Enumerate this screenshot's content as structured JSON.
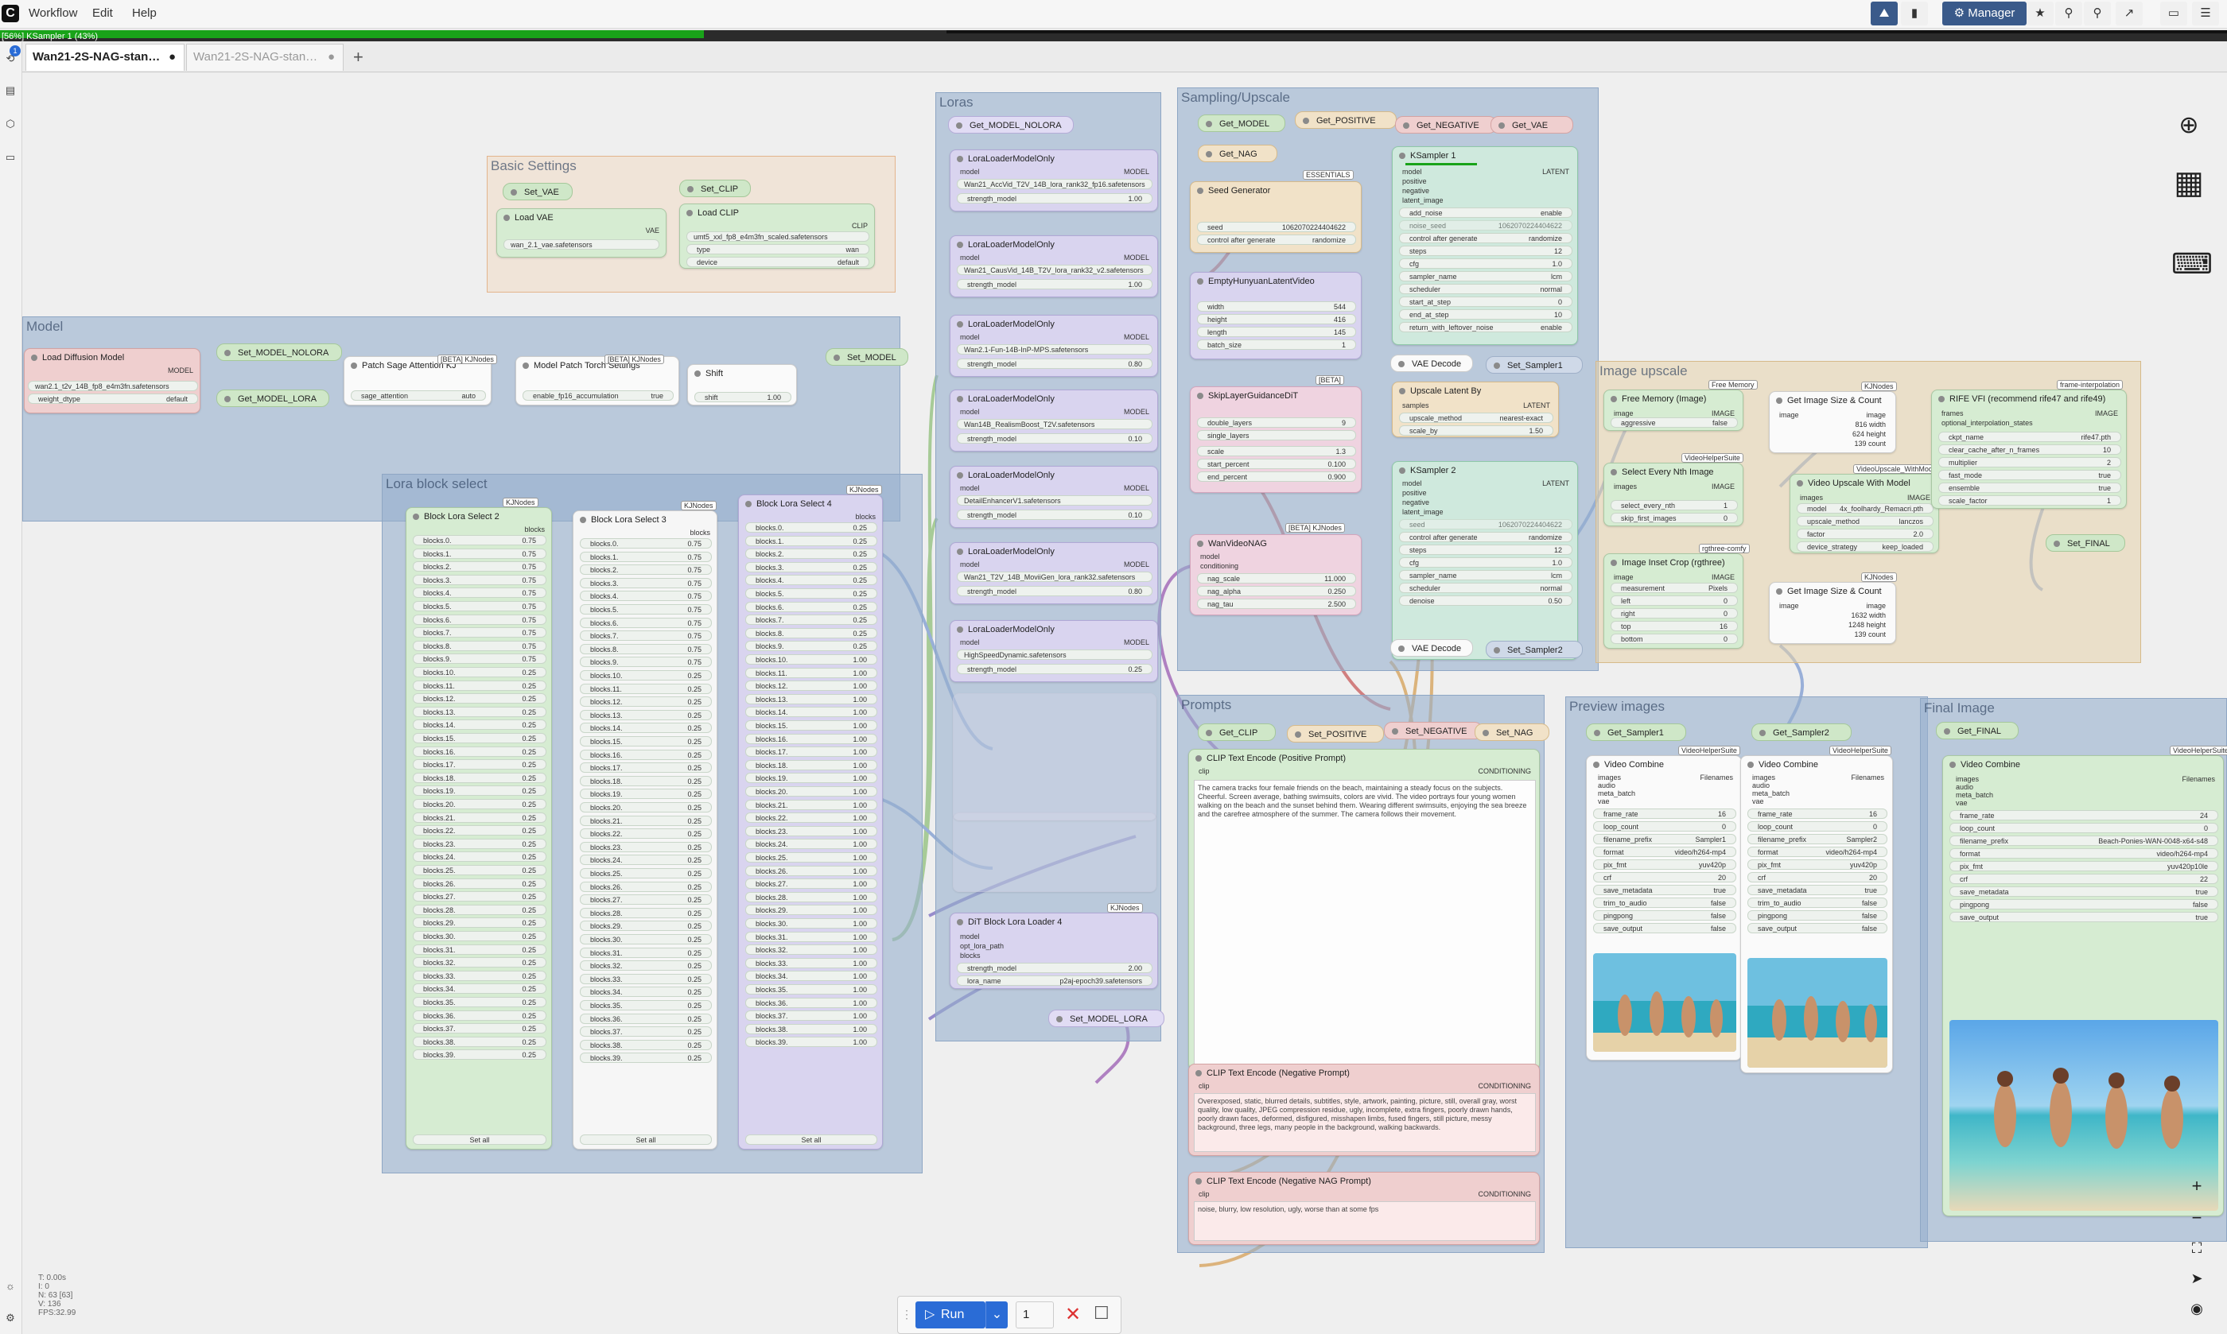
{
  "menu": {
    "items": [
      "Workflow",
      "Edit",
      "Help"
    ],
    "logo": "C"
  },
  "toolbar": {
    "manager_label": "Manager"
  },
  "progress": {
    "text": "[56%] KSampler 1 (43%)",
    "fraction": 0.56,
    "color": "#19a319"
  },
  "tabs": [
    {
      "label": "Wan21-2S-NAG-stan…",
      "active": true
    },
    {
      "label": "Wan21-2S-NAG-stan…",
      "active": false
    }
  ],
  "tab_add": "+",
  "sidebar": {
    "badge_count": "1"
  },
  "groups": {
    "basic_settings": "Basic Settings",
    "model": "Model",
    "lora_block_select": "Lora block select",
    "loras": "Loras",
    "sampling": "Sampling/Upscale",
    "image_upscale": "Image upscale",
    "prompts": "Prompts",
    "preview_images": "Preview images",
    "final_image": "Final Image"
  },
  "basic_settings": {
    "set_vae": "Set_VAE",
    "set_clip": "Set_CLIP",
    "load_vae": "Load VAE",
    "load_clip": "Load CLIP",
    "vae_name": "wan_2.1_vae.safetensors",
    "clip_name": "umt5_xxl_fp8_e4m3fn_scaled.safetensors",
    "clip_type": "wan",
    "clip_device": "default",
    "vae_out": "VAE",
    "clip_out": "CLIP"
  },
  "model": {
    "load_diffusion": "Load Diffusion Model",
    "unet_name": "wan2.1_t2v_14B_fp8_e4m3fn.safetensors",
    "weight_dtype": "default",
    "set_model_nolora": "Set_MODEL_NOLORA",
    "get_model_lora": "Get_MODEL_LORA",
    "patch_sage": "Patch Sage Attention KJ",
    "sage_attention": "auto",
    "patch_torch": "Model Patch Torch Settings",
    "enable_fp16": "true",
    "shift": "Shift",
    "shift_value": "1.00",
    "set_model": "Set_MODEL",
    "badge_kjnodes": "KJNodes",
    "badge_beta": "[BETA] KJNodes"
  },
  "block_lora": {
    "nodes": [
      {
        "title": "Block Lora Select 2"
      },
      {
        "title": "Block Lora Select 3"
      },
      {
        "title": "Block Lora Select 4"
      }
    ],
    "values": [
      [
        "0.75",
        "0.75",
        "0.75",
        "0.75",
        "0.75",
        "0.75",
        "0.75",
        "0.75",
        "0.75",
        "0.75",
        "0.25",
        "0.25",
        "0.25",
        "0.25",
        "0.25",
        "0.25",
        "0.25",
        "0.25",
        "0.25",
        "0.25",
        "0.25",
        "0.25",
        "0.25",
        "0.25",
        "0.25",
        "0.25",
        "0.25",
        "0.25",
        "0.25",
        "0.25",
        "0.25",
        "0.25",
        "0.25",
        "0.25",
        "0.25",
        "0.25",
        "0.25",
        "0.25",
        "0.25",
        "0.25"
      ],
      [
        "0.75",
        "0.75",
        "0.75",
        "0.75",
        "0.75",
        "0.75",
        "0.75",
        "0.75",
        "0.75",
        "0.75",
        "0.25",
        "0.25",
        "0.25",
        "0.25",
        "0.25",
        "0.25",
        "0.25",
        "0.25",
        "0.25",
        "0.25",
        "0.25",
        "0.25",
        "0.25",
        "0.25",
        "0.25",
        "0.25",
        "0.25",
        "0.25",
        "0.25",
        "0.25",
        "0.25",
        "0.25",
        "0.25",
        "0.25",
        "0.25",
        "0.25",
        "0.25",
        "0.25",
        "0.25",
        "0.25"
      ],
      [
        "0.25",
        "0.25",
        "0.25",
        "0.25",
        "0.25",
        "0.25",
        "0.25",
        "0.25",
        "0.25",
        "0.25",
        "1.00",
        "1.00",
        "1.00",
        "1.00",
        "1.00",
        "1.00",
        "1.00",
        "1.00",
        "1.00",
        "1.00",
        "1.00",
        "1.00",
        "1.00",
        "1.00",
        "1.00",
        "1.00",
        "1.00",
        "1.00",
        "1.00",
        "1.00",
        "1.00",
        "1.00",
        "1.00",
        "1.00",
        "1.00",
        "1.00",
        "1.00",
        "1.00",
        "1.00",
        "1.00"
      ]
    ],
    "output": "blocks",
    "set_all": "Set all"
  },
  "loras": {
    "get_model_nolora": "Get_MODEL_NOLORA",
    "nodes": [
      {
        "title": "LoraLoaderModelOnly",
        "lora": "Wan21_AccVid_T2V_14B_lora_rank32_fp16.safetensors",
        "strength": "1.00"
      },
      {
        "title": "LoraLoaderModelOnly",
        "lora": "Wan21_CausVid_14B_T2V_lora_rank32_v2.safetensors",
        "strength": "1.00"
      },
      {
        "title": "LoraLoaderModelOnly",
        "lora": "Wan2.1-Fun-14B-InP-MPS.safetensors",
        "strength": "0.80"
      },
      {
        "title": "LoraLoaderModelOnly",
        "lora": "Wan14B_RealismBoost_T2V.safetensors",
        "strength": "0.10"
      },
      {
        "title": "LoraLoaderModelOnly",
        "lora": "DetailEnhancerV1.safetensors",
        "strength": "0.10"
      },
      {
        "title": "LoraLoaderModelOnly",
        "lora": "Wan21_T2V_14B_MoviiGen_lora_rank32.safetensors",
        "strength": "0.80"
      },
      {
        "title": "LoraLoaderModelOnly",
        "lora": "HighSpeedDynamic.safetensors",
        "strength": "0.25"
      }
    ],
    "dit_block_lora": "DiT Block Lora Loader 4",
    "dit_strength": "2.00",
    "dit_lora": "p2aj-epoch39.safetensors",
    "set_model_lora": "Set_MODEL_LORA"
  },
  "sampling": {
    "get_model": "Get_MODEL",
    "get_positive": "Get_POSITIVE",
    "get_negative": "Get_NEGATIVE",
    "get_vae": "Get_VAE",
    "get_nag": "Get_NAG",
    "seed_generator": "Seed Generator",
    "seed": "1062070224404622",
    "control": "randomize",
    "empty_latent": "EmptyHunyuanLatentVideo",
    "width": "544",
    "height": "416",
    "length": "145",
    "batch_size": "1",
    "skip_layer": "SkipLayerGuidanceDiT",
    "double_layers": "9",
    "single_layers": "",
    "scale": "1.3",
    "start_percent": "0.100",
    "end_percent": "0.900",
    "wan_video_nag": "WanVideoNAG",
    "nag_scale": "11.000",
    "nag_alpha": "0.250",
    "nag_tau": "2.500",
    "ksampler1": "KSampler 1",
    "ksampler2": "KSampler 2",
    "add_noise": "enable",
    "steps": "12",
    "cfg": "1.0",
    "sampler_name": "lcm",
    "scheduler": "normal",
    "start_step": "0",
    "end_step": "10",
    "return_noise": "enable",
    "ks2_start": "10",
    "ks2_end": "10000",
    "ks2_denoise": "0.50",
    "vae_decode": "VAE Decode",
    "set_sampler1": "Set_Sampler1",
    "set_sampler2": "Set_Sampler2",
    "upscale_latent": "Upscale Latent By",
    "upscale_method": "nearest-exact",
    "scale_by": "1.50",
    "ks_progress": 0.43
  },
  "image_upscale": {
    "free_memory": "Free Memory (Image)",
    "aggressive": "false",
    "select_every": "Select Every Nth Image",
    "select_every_nth": "1",
    "skip_first": "0",
    "crop": "Image Inset Crop (rgthree)",
    "measurement": "Pixels",
    "left": "0",
    "right": "0",
    "top": "16",
    "bottom": "0",
    "get_size1": "Get Image Size & Count",
    "w1": "816 width",
    "h1": "624 height",
    "c1": "139 count",
    "upscale_model": "Video Upscale With Model",
    "model_name": "4x_foolhardy_Remacri.pth",
    "upscale_method": "lanczos",
    "factor": "2.0",
    "device": "keep_loaded",
    "get_size2": "Get Image Size & Count",
    "w2": "1632 width",
    "h2": "1248 height",
    "c2": "139 count",
    "rife": "RIFE VFI (recommend rife47 and rife49)",
    "ckpt_name": "rife47.pth",
    "clear_cache": "10",
    "multiplier": "2",
    "fast_mode": "true",
    "ensemble": "true",
    "scale_factor": "1",
    "set_final": "Set_FINAL"
  },
  "prompts": {
    "get_clip": "Get_CLIP",
    "set_positive": "Set_POSITIVE",
    "set_negative": "Set_NEGATIVE",
    "set_nag": "Set_NAG",
    "positive_title": "CLIP Text Encode (Positive Prompt)",
    "positive_text": "The camera tracks four female friends on the beach, maintaining a steady focus on the subjects. Cheerful. Screen average, bathing swimsuits, colors are vivid. The video portrays four young women walking on the beach and the sunset behind them. Wearing different swimsuits, enjoying the sea breeze and the carefree atmosphere of the summer. The camera follows their movement.",
    "negative_title": "CLIP Text Encode (Negative Prompt)",
    "negative_text": "Overexposed, static, blurred details, subtitles, style, artwork, painting, picture, still, overall gray, worst quality, low quality, JPEG compression residue, ugly, incomplete, extra fingers, poorly drawn hands, poorly drawn faces, deformed, disfigured, misshapen limbs, fused fingers, still picture, messy background, three legs, many people in the background, walking backwards.",
    "nag_title": "CLIP Text Encode (Negative NAG Prompt)",
    "nag_text": "noise, blurry, low resolution, ugly, worse than at some fps",
    "clip": "clip",
    "conditioning": "CONDITIONING"
  },
  "preview": {
    "get_sampler1": "Get_Sampler1",
    "get_sampler2": "Get_Sampler2",
    "combine": "Video Combine",
    "frame_rate": "16",
    "loop_count": "0",
    "prefix1": "Sampler1",
    "prefix2": "Sampler2",
    "format": "video/h264-mp4",
    "pix_fmt": "yuv420p",
    "crf": "20",
    "save_metadata": "true",
    "trim_to_audio": "false",
    "pingpong": "false",
    "save_output": "false"
  },
  "final": {
    "get_final": "Get_FINAL",
    "combine": "Video Combine",
    "frame_rate": "24",
    "loop_count": "0",
    "prefix": "Beach-Ponies-WAN-0048-x64-s48",
    "format": "video/h264-mp4",
    "pix_fmt": "yuv420p10le",
    "crf": "22",
    "save_metadata": "true",
    "pingpong": "false",
    "save_output": "true"
  },
  "badges": {
    "videohelper": "VideoHelperSuite",
    "kjnodes": "KJNodes",
    "beta": "[BETA]",
    "rgthree": "rgthree-comfy",
    "frame_interp": "frame-interpolation",
    "free_memory": "Free Memory",
    "videoupscale": "VideoUpscale_WithModel",
    "essentials": "ESSENTIALS"
  },
  "run": {
    "label": "Run",
    "batch": "1"
  },
  "stats": {
    "t": "T: 0.00s",
    "i": "I: 0",
    "n": "N: 63 [63]",
    "v": "V: 136",
    "fps": "FPS:32.99"
  },
  "colors": {
    "accent": "#2a6cd6",
    "green_node": "#d6ecd2",
    "purple_node": "#d9d4ef",
    "pink_node": "#efd3e0",
    "orange_node": "#f1e2c8",
    "red_node": "#efcfcf"
  }
}
